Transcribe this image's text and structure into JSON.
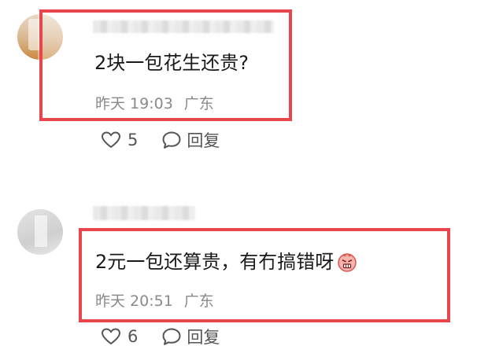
{
  "comments": [
    {
      "text": "2块一包花生还贵?",
      "time": "昨天 19:03",
      "location": "广东",
      "likes": "5",
      "reply_label": "回复",
      "emoji": ""
    },
    {
      "text": "2元一包还算贵，有冇搞错呀",
      "time": "昨天 20:51",
      "location": "广东",
      "likes": "6",
      "reply_label": "回复",
      "emoji": "angry-face-emoji"
    }
  ],
  "colors": {
    "highlight_border": "#e8454d",
    "text_primary": "#1a1a1a",
    "text_meta": "#8a8a8a",
    "action_text": "#555555"
  },
  "icons": {
    "like": "heart-outline-icon",
    "reply": "speech-bubble-icon"
  }
}
